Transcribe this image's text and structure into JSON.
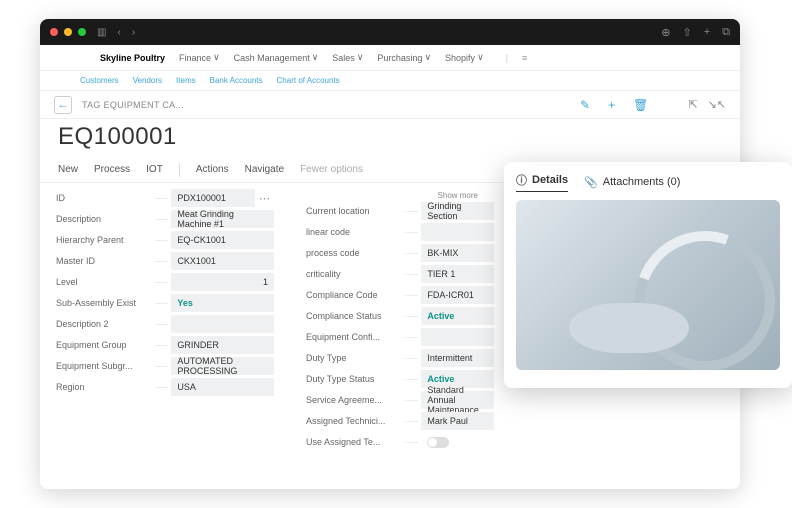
{
  "window": {
    "brand": "Skyline Poultry",
    "menus": [
      "Finance",
      "Cash Management",
      "Sales",
      "Purchasing",
      "Shopify"
    ],
    "submenus": [
      "Customers",
      "Vendors",
      "Items",
      "Bank Accounts",
      "Chart of Accounts"
    ]
  },
  "page": {
    "crumb": "TAG EQUIPMENT CA...",
    "title": "EQ100001",
    "tabs": [
      "New",
      "Process",
      "IOT"
    ],
    "tabs2": [
      "Actions",
      "Navigate"
    ],
    "fewer": "Fewer options",
    "showmore": "Show more"
  },
  "col1": [
    {
      "label": "ID",
      "value": "PDX100001",
      "ellips": true
    },
    {
      "label": "Description",
      "value": "Meat Grinding Machine #1"
    },
    {
      "label": "Hierarchy Parent",
      "value": "EQ-CK1001"
    },
    {
      "label": "Master ID",
      "value": "CKX1001"
    },
    {
      "label": "Level",
      "value": "1",
      "right": true
    },
    {
      "label": "Sub-Assembly Exist",
      "value": "Yes",
      "teal": true
    },
    {
      "label": "Description 2",
      "value": ""
    },
    {
      "label": "Equipment Group",
      "value": "GRINDER"
    },
    {
      "label": "Equipment Subgr...",
      "value": "AUTOMATED PROCESSING"
    },
    {
      "label": "Region",
      "value": "USA"
    }
  ],
  "col2": [
    {
      "label": "Current location",
      "value": "Grinding Section"
    },
    {
      "label": "linear code",
      "value": ""
    },
    {
      "label": "process code",
      "value": "BK-MIX"
    },
    {
      "label": "criticality",
      "value": "TIER 1"
    },
    {
      "label": "Compliance Code",
      "value": "FDA-ICR01"
    },
    {
      "label": "Compliance Status",
      "value": "Active",
      "teal": true
    },
    {
      "label": "Equipment Confi...",
      "value": ""
    },
    {
      "label": "Duty Type",
      "value": "Intermittent"
    },
    {
      "label": "Duty Type Status",
      "value": "Active",
      "teal": true
    },
    {
      "label": "Service Agreeme...",
      "value": "Standard Annual Maintenance"
    },
    {
      "label": "Assigned Technici...",
      "value": "Mark Paul"
    },
    {
      "label": "Use Assigned Te...",
      "value": "",
      "toggle": true
    }
  ],
  "card": {
    "details": "Details",
    "attachments": "Attachments (0)"
  }
}
